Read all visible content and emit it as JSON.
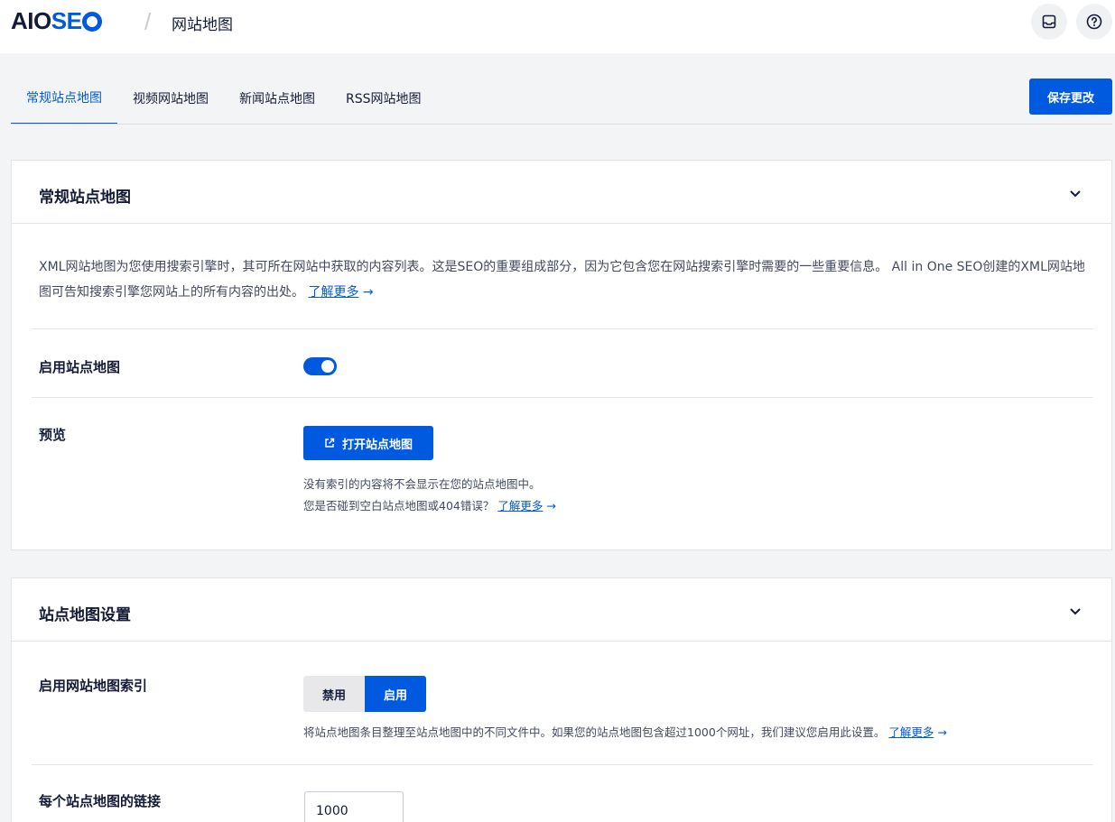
{
  "header": {
    "logo_text_1": "AIO",
    "logo_text_2": "SE",
    "separator": "/",
    "breadcrumb": "网站地图"
  },
  "tabs": [
    {
      "label": "常规站点地图",
      "active": true
    },
    {
      "label": "视频网站地图",
      "active": false
    },
    {
      "label": "新闻站点地图",
      "active": false
    },
    {
      "label": "RSS网站地图",
      "active": false
    }
  ],
  "save_button": "保存更改",
  "general_card": {
    "title": "常规站点地图",
    "description": "XML网站地图为您使用搜索引擎时，其可所在网站中获取的内容列表。这是SEO的重要组成部分，因为它包含您在网站搜索引擎时需要的一些重要信息。 All in One SEO创建的XML网站地图可告知搜索引擎您网站上的所有内容的出处。",
    "learn_more": "了解更多",
    "arrow": "→",
    "enable_label": "启用站点地图",
    "enable_on": true,
    "preview_label": "预览",
    "open_button": "打开站点地图",
    "note1": "没有索引的内容将不会显示在您的站点地图中。",
    "note2": "您是否碰到空白站点地图或404错误？",
    "note2_link": "了解更多"
  },
  "settings_card": {
    "title": "站点地图设置",
    "index_label": "启用网站地图索引",
    "opt_off": "禁用",
    "opt_on": "启用",
    "index_note": "将站点地图条目整理至站点地图中的不同文件中。如果您的站点地图包含超过1000个网址，我们建议您启用此设置。",
    "index_link": "了解更多",
    "links_label": "每个站点地图的链接",
    "links_value": "1000"
  },
  "colors": {
    "accent": "#005ae0",
    "text": "#141b38",
    "muted": "#434960"
  }
}
